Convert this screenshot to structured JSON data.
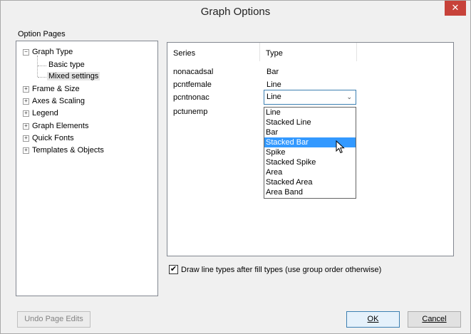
{
  "window": {
    "title": "Graph Options",
    "close_glyph": "✕"
  },
  "option_pages": {
    "label": "Option Pages",
    "tree": [
      {
        "label": "Graph Type",
        "expanded": true,
        "children": [
          "Basic type",
          "Mixed settings"
        ],
        "selected_child": "Mixed settings"
      },
      {
        "label": "Frame & Size"
      },
      {
        "label": "Axes & Scaling"
      },
      {
        "label": "Legend"
      },
      {
        "label": "Graph Elements"
      },
      {
        "label": "Quick Fonts"
      },
      {
        "label": "Templates & Objects"
      }
    ]
  },
  "series_table": {
    "columns": [
      "Series",
      "Type"
    ],
    "rows": [
      {
        "series": "nonacadsal",
        "type": "Bar"
      },
      {
        "series": "pcntfemale",
        "type": "Line"
      },
      {
        "series": "pcntnonac",
        "type": "Line"
      },
      {
        "series": "pctunemp",
        "type": ""
      }
    ]
  },
  "type_combo": {
    "value": "Line",
    "options": [
      "Line",
      "Stacked Line",
      "Bar",
      "Stacked Bar",
      "Spike",
      "Stacked Spike",
      "Area",
      "Stacked Area",
      "Area Band"
    ],
    "highlighted": "Stacked Bar"
  },
  "draw_order_checkbox": {
    "checked": true,
    "label": "Draw line types after fill types (use group order otherwise)"
  },
  "buttons": {
    "undo": "Undo Page Edits",
    "ok": "OK",
    "cancel": "Cancel"
  },
  "colors": {
    "accent": "#3399ff",
    "close": "#c7423a"
  }
}
